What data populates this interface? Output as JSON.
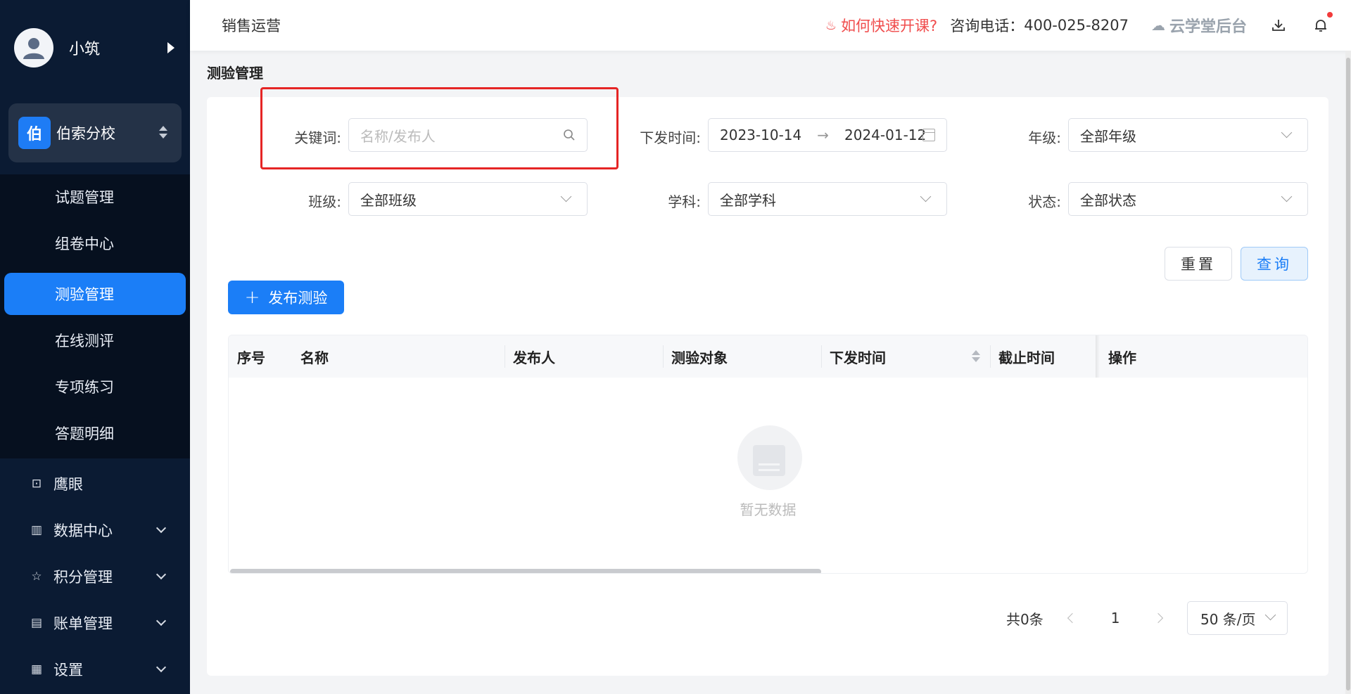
{
  "user": {
    "name": "小筑"
  },
  "school": {
    "badge": "伯",
    "name": "伯索分校"
  },
  "submenu": [
    {
      "label": "试题管理",
      "active": false
    },
    {
      "label": "组卷中心",
      "active": false
    },
    {
      "label": "测验管理",
      "active": true
    },
    {
      "label": "在线测评",
      "active": false
    },
    {
      "label": "专项练习",
      "active": false
    },
    {
      "label": "答题明细",
      "active": false
    }
  ],
  "menu": [
    {
      "label": "鹰眼",
      "icon": "eagle-eye-icon",
      "glyph": "⊡"
    },
    {
      "label": "数据中心",
      "icon": "chart-icon",
      "glyph": "▥"
    },
    {
      "label": "积分管理",
      "icon": "star-icon",
      "glyph": "☆"
    },
    {
      "label": "账单管理",
      "icon": "bill-icon",
      "glyph": "▤"
    },
    {
      "label": "设置",
      "icon": "settings-icon",
      "glyph": "▦"
    }
  ],
  "topbar": {
    "title": "销售运营",
    "help": "如何快速开课?",
    "phone_label": "咨询电话：",
    "phone": "400-025-8207",
    "brand": "云学堂后台"
  },
  "breadcrumb": "测验管理",
  "filters": {
    "keyword_label": "关键词:",
    "keyword_placeholder": "名称/发布人",
    "time_label": "下发时间:",
    "date_start": "2023-10-14",
    "date_end": "2024-01-12",
    "date_sep": "→",
    "grade_label": "年级:",
    "grade_value": "全部年级",
    "class_label": "班级:",
    "class_value": "全部班级",
    "subject_label": "学科:",
    "subject_value": "全部学科",
    "status_label": "状态:",
    "status_value": "全部状态"
  },
  "buttons": {
    "reset": "重置",
    "query": "查询",
    "publish": "发布测验",
    "publish_icon": "+"
  },
  "table": {
    "columns": [
      "序号",
      "名称",
      "发布人",
      "测验对象",
      "下发时间",
      "截止时间",
      "操作"
    ],
    "empty_text": "暂无数据"
  },
  "pagination": {
    "total": "共0条",
    "page": "1",
    "page_size": "50 条/页"
  },
  "colors": {
    "primary": "#1b7ef7",
    "sidebar": "#0b1b33",
    "highlight": "#e52525",
    "help": "#f04d4d"
  }
}
